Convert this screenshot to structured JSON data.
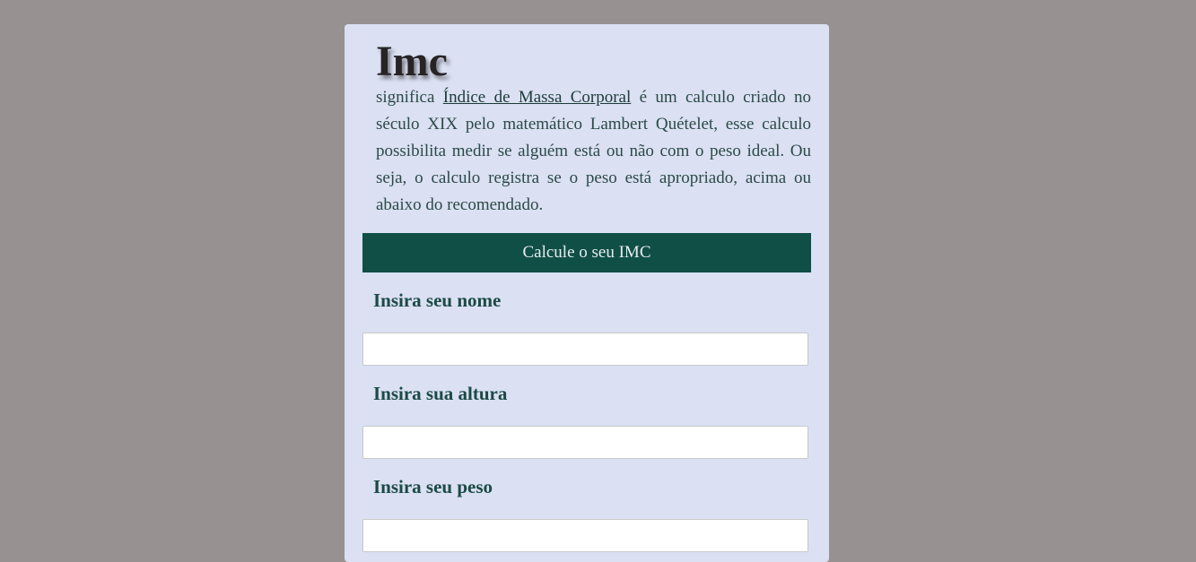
{
  "card": {
    "title": "Imc",
    "description": {
      "prefix": "significa ",
      "link_text": "Índice de Massa Corporal",
      "suffix": " é um calculo criado no século XIX pelo matemático Lambert Quételet, esse calculo possibilita medir se alguém está ou não com o peso ideal. Ou seja, o calculo registra se o peso está apropriado, acima ou abaixo do recomendado."
    },
    "calc_button_label": "Calcule o seu IMC"
  },
  "form": {
    "name_label": "Insira seu nome",
    "name_value": "",
    "height_label": "Insira sua altura",
    "height_value": "",
    "weight_label": "Insira seu peso",
    "weight_value": ""
  },
  "colors": {
    "page_background": "#979191",
    "card_background": "#dbe0f3",
    "accent": "#0f4f46",
    "label_text": "#1b4a45"
  }
}
